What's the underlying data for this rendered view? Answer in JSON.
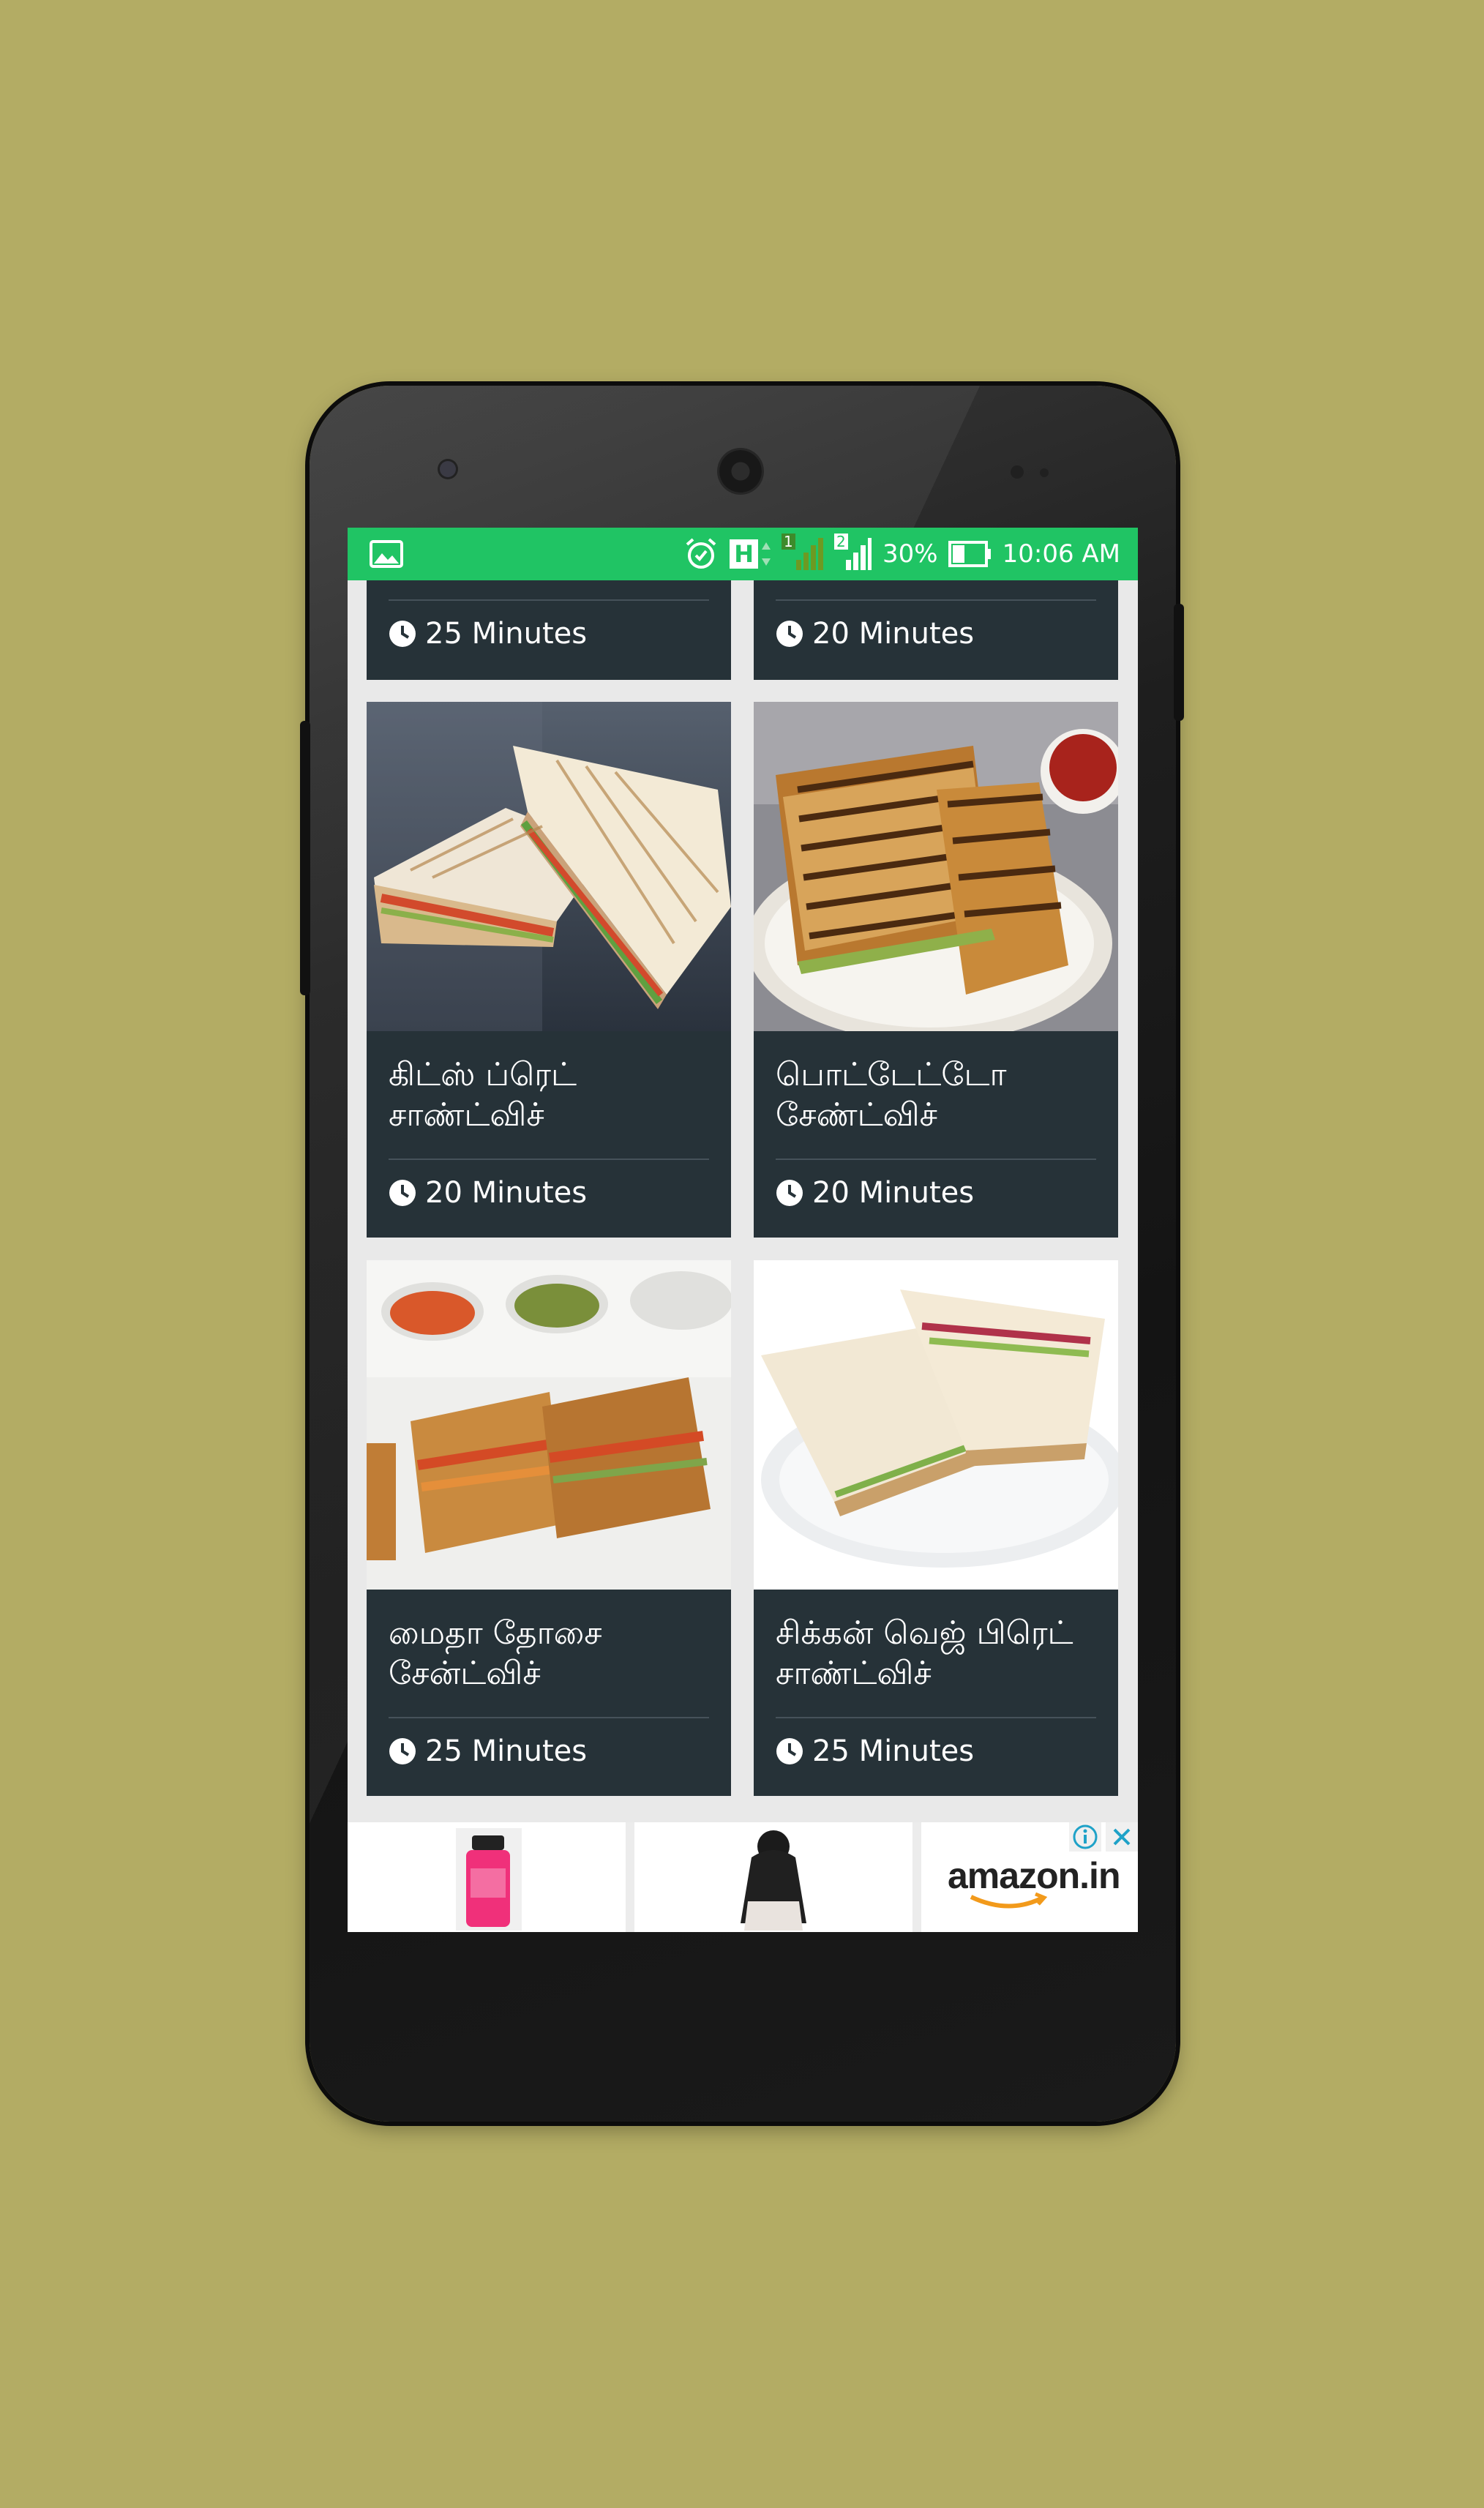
{
  "status_bar": {
    "network_type": "H",
    "sim1_label": "1",
    "sim2_label": "2",
    "battery_percent": "30%",
    "time": "10:06 AM",
    "colors": {
      "bar": "#20c464"
    }
  },
  "recipes": [
    {
      "title": "",
      "time": "25 Minutes",
      "image": "food-photo"
    },
    {
      "title": "",
      "time": "20 Minutes",
      "image": "food-photo"
    },
    {
      "title": "கிட்ஸ் ப்ரெட் சாண்ட்விச்",
      "time": "20 Minutes",
      "image": "grilled-sandwich-photo"
    },
    {
      "title": "பொட்டேட்டோ சேண்ட்விச்",
      "time": "20 Minutes",
      "image": "potato-sandwich-photo"
    },
    {
      "title": "மைதா தோசை சேன்ட்விச்",
      "time": "25 Minutes",
      "image": "dosa-sandwich-photo"
    },
    {
      "title": "சிக்கன் வெஜ் பிரெட் சாண்ட்விச்",
      "time": "25 Minutes",
      "image": "chicken-sandwich-photo"
    }
  ],
  "ad_banner": {
    "brand": "amazon.in",
    "items": [
      "water-bottle-product",
      "hair-extension-product"
    ]
  },
  "colors": {
    "background": "#b3ac64",
    "card": "#263238",
    "screen_bg": "#e9e9e9"
  }
}
